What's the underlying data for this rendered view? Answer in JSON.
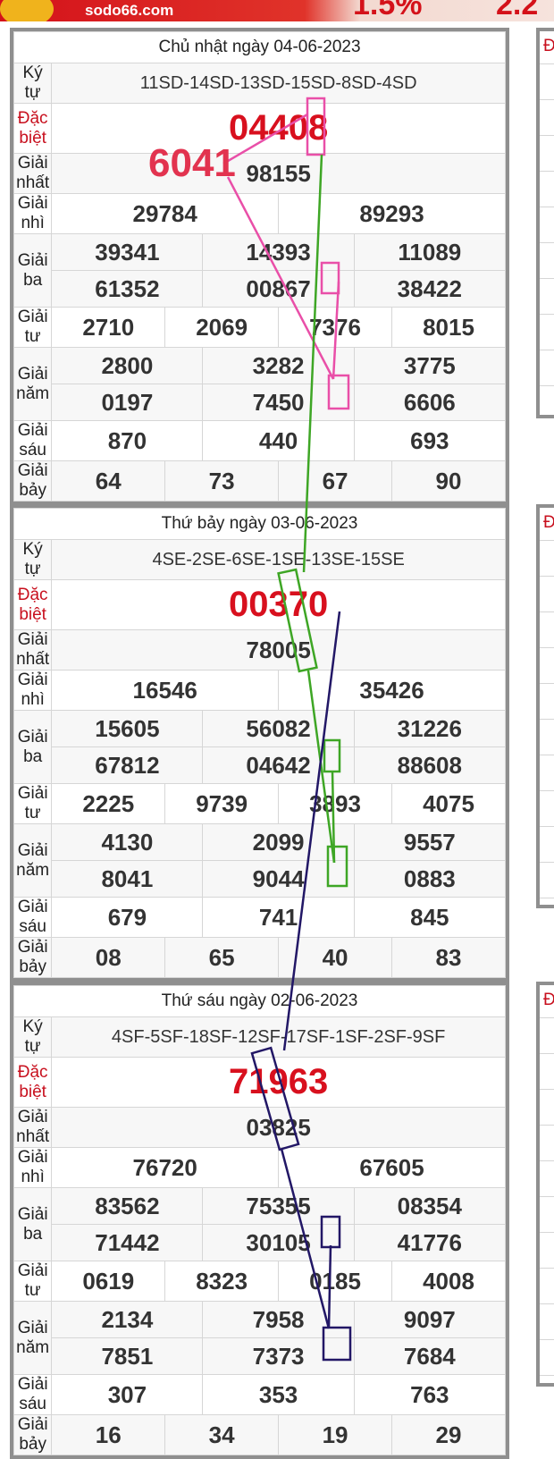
{
  "banner": {
    "site": "sodo66.com",
    "rate_left": "1.5%",
    "rate_right": "2.2"
  },
  "side_labels": [
    "Đ",
    "Đ",
    "Đ"
  ],
  "labels": {
    "ky_tu": "Ký tự",
    "dac_biet": "Đặc biệt",
    "giai_nhat": "Giải nhất",
    "giai_nhi": "Giải nhì",
    "giai_ba": "Giải ba",
    "giai_tu": "Giải tư",
    "giai_nam": "Giải năm",
    "giai_sau": "Giải sáu",
    "giai_bay": "Giải bảy"
  },
  "annotation": {
    "highlight_number": "6041"
  },
  "results": [
    {
      "date": "Chủ nhật ngày 04-06-2023",
      "ky_tu": "11SD-14SD-13SD-15SD-8SD-4SD",
      "dac_biet": "04408",
      "giai_nhat": "98155",
      "giai_nhi": [
        "29784",
        "89293"
      ],
      "giai_ba": [
        "39341",
        "14393",
        "11089",
        "61352",
        "00867",
        "38422"
      ],
      "giai_tu": [
        "2710",
        "2069",
        "7376",
        "8015"
      ],
      "giai_nam": [
        "2800",
        "3282",
        "3775",
        "0197",
        "7450",
        "6606"
      ],
      "giai_sau": [
        "870",
        "440",
        "693"
      ],
      "giai_bay": [
        "64",
        "73",
        "67",
        "90"
      ]
    },
    {
      "date": "Thứ bảy ngày 03-06-2023",
      "ky_tu": "4SE-2SE-6SE-1SE-13SE-15SE",
      "dac_biet": "00370",
      "giai_nhat": "78005",
      "giai_nhi": [
        "16546",
        "35426"
      ],
      "giai_ba": [
        "15605",
        "56082",
        "31226",
        "67812",
        "04642",
        "88608"
      ],
      "giai_tu": [
        "2225",
        "9739",
        "3893",
        "4075"
      ],
      "giai_nam": [
        "4130",
        "2099",
        "9557",
        "8041",
        "9044",
        "0883"
      ],
      "giai_sau": [
        "679",
        "741",
        "845"
      ],
      "giai_bay": [
        "08",
        "65",
        "40",
        "83"
      ]
    },
    {
      "date": "Thứ sáu ngày 02-06-2023",
      "ky_tu": "4SF-5SF-18SF-12SF-17SF-1SF-2SF-9SF",
      "dac_biet": "71963",
      "giai_nhat": "03825",
      "giai_nhi": [
        "76720",
        "67605"
      ],
      "giai_ba": [
        "83562",
        "75355",
        "08354",
        "71442",
        "30105",
        "41776"
      ],
      "giai_tu": [
        "0619",
        "8323",
        "0185",
        "4008"
      ],
      "giai_nam": [
        "2134",
        "7958",
        "9097",
        "7851",
        "7373",
        "7684"
      ],
      "giai_sau": [
        "307",
        "353",
        "763"
      ],
      "giai_bay": [
        "16",
        "34",
        "19",
        "29"
      ]
    }
  ]
}
